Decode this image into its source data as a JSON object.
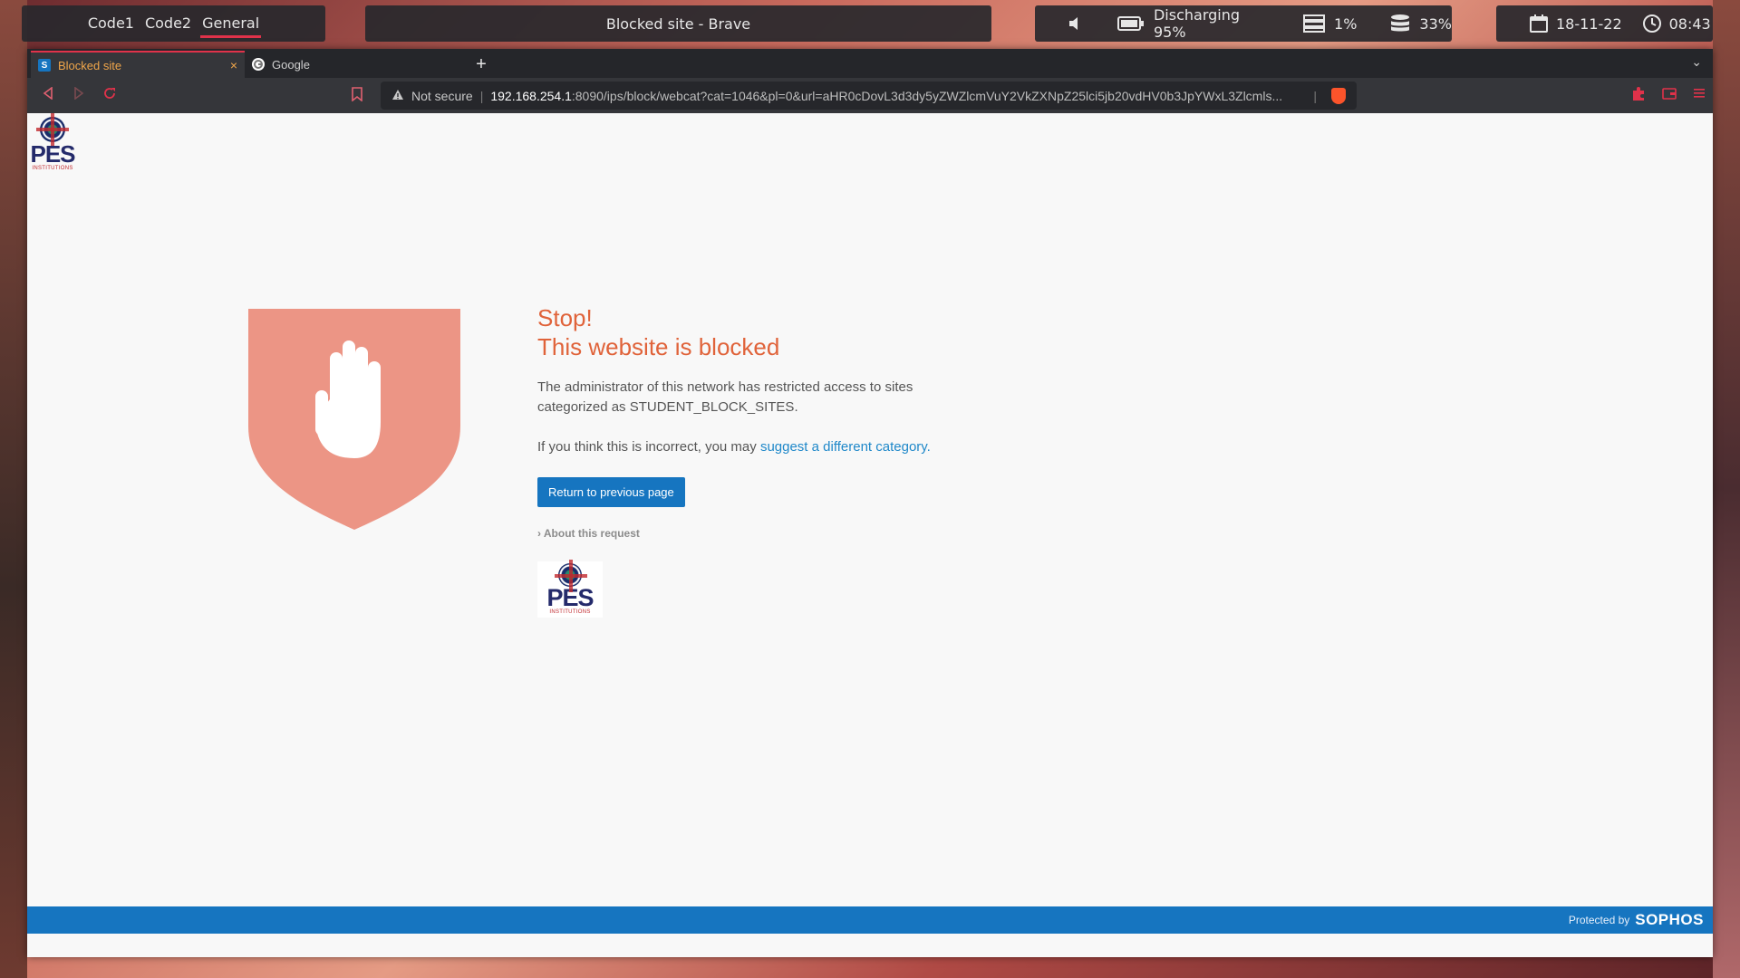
{
  "panel": {
    "workspaces": [
      "Code1",
      "Code2",
      "General"
    ],
    "window_title": "Blocked site - Brave",
    "battery": "Discharging 95%",
    "cpu": "1%",
    "disk": "33%",
    "date": "18-11-22",
    "time": "08:43"
  },
  "browser": {
    "tabs": [
      {
        "label": "Blocked site",
        "favicon": "S",
        "close": "×"
      },
      {
        "label": "Google"
      }
    ],
    "new_tab": "+",
    "url_security": "Not secure",
    "url_host": "192.168.254.1",
    "url_path": ":8090/ips/block/webcat?cat=1046&pl=0&url=aHR0cDovL3d3dy5yZWZlcmVuY2VkZXNpZ25lci5jb20vdHV0b3JpYWxL3Zlcmls..."
  },
  "page": {
    "logo_text": "PES",
    "logo_sub": "INSTITUTIONS",
    "title_line1": "Stop!",
    "title_line2": "This website is blocked",
    "description": "The administrator of this network has restricted access to sites categorized as STUDENT_BLOCK_SITES.",
    "incorrect_prefix": "If you think this is incorrect, you may ",
    "incorrect_link": "suggest a different category.",
    "return_button": "Return to previous page",
    "about_request": "About this request",
    "footer_protected": "Protected by",
    "footer_brand": "SOPHOS"
  },
  "colors": {
    "accent": "#e0324a",
    "shield": "#ec9585",
    "title": "#e0633a",
    "link": "#1f88c9",
    "button": "#1675c0"
  }
}
